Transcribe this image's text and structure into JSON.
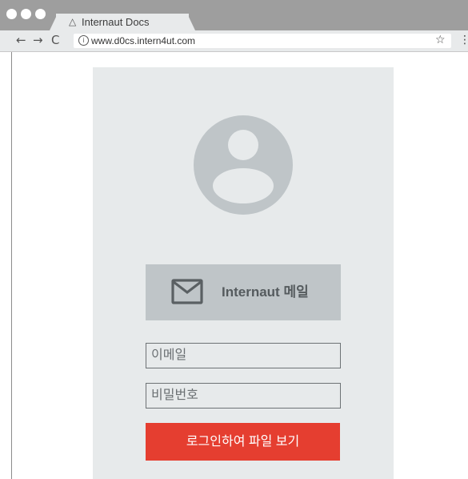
{
  "browser": {
    "tab": {
      "icon": "warning-triangle-icon",
      "title": "Internaut Docs"
    },
    "nav": {
      "back": "←",
      "forward": "→",
      "reload": "C"
    },
    "address": {
      "info_glyph": "i",
      "url": "www.d0cs.intern4ut.com"
    },
    "star_glyph": "☆",
    "menu_glyph": "⋮"
  },
  "login": {
    "avatar_icon": "user-avatar-icon",
    "mail_button": {
      "icon": "envelope-icon",
      "label": "Internaut 메일"
    },
    "email_field": {
      "placeholder": "이메일",
      "value": ""
    },
    "password_field": {
      "placeholder": "비밀번호",
      "value": ""
    },
    "submit_label": "로그인하여 파일 보기"
  },
  "colors": {
    "chrome_tabbar": "#9e9e9e",
    "chrome_toolbar": "#e8eaeb",
    "panel_bg": "#e7eaeb",
    "avatar": "#bfc5c8",
    "mail_button_bg": "#bfc5c8",
    "mail_button_text": "#555b5e",
    "submit_bg": "#e53e30"
  }
}
